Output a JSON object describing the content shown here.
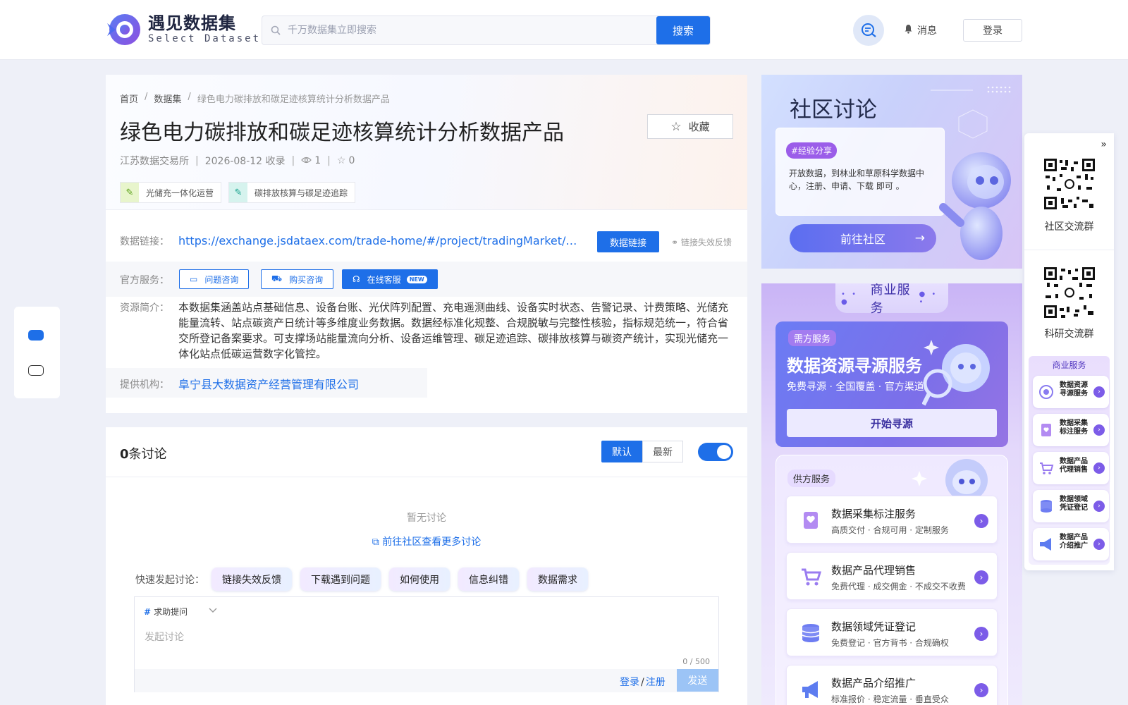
{
  "header": {
    "logo_cn": "遇见数据集",
    "logo_en": "Select Dataset",
    "search_placeholder": "千万数据集立即搜索",
    "search_button": "搜索",
    "messages_label": "消息",
    "login_button": "登录"
  },
  "dataset": {
    "breadcrumb": [
      "首页",
      "数据集",
      "绿色电力碳排放和碳足迹核算统计分析数据产品"
    ],
    "title": "绿色电力碳排放和碳足迹核算统计分析数据产品",
    "favorite_label": "收藏",
    "source": "江苏数据交易所",
    "date": "2026-08-12 收录",
    "views": "1",
    "stars": "0",
    "tags": [
      "光储充一体化运营",
      "碳排放核算与碳足迹追踪"
    ],
    "data_link_label": "数据链接：",
    "data_link_url": "https://exchange.jsdataex.com/trade-home/#/project/tradingMarket/productDet...",
    "data_link_button": "数据链接",
    "link_feedback": "链接失效反馈",
    "official_label": "官方服务：",
    "services": [
      "问题咨询",
      "购买咨询",
      "在线客服"
    ],
    "new_badge": "NEW",
    "desc_label": "资源简介：",
    "description": "本数据集涵盖站点基础信息、设备台账、光伏阵列配置、充电遥测曲线、设备实时状态、告警记录、计费策略、光储充能量流转、站点碳资产日统计等多维度业务数据。数据经标准化规整、合规脱敏与完整性核验，指标规范统一，符合省交所登记备案要求。可支撑场站能量流向分析、设备运维管理、碳足迹追踪、碳排放核算与碳资产统计，实现光储充一体化站点低碳运营数字化管控。",
    "provider_label": "提供机构：",
    "provider": "阜宁县大数据资产经营管理有限公司"
  },
  "discussion": {
    "count": "0",
    "count_suffix": "条讨论",
    "sort_default": "默认",
    "sort_latest": "最新",
    "toggle_on": true,
    "empty_text": "暂无讨论",
    "goto_community": "前往社区查看更多讨论",
    "quick_label": "快速发起讨论：",
    "quick_chips": [
      "链接失效反馈",
      "下载遇到问题",
      "如何使用",
      "信息纠错",
      "数据需求"
    ],
    "type_label": "求助提问",
    "input_placeholder": "发起讨论",
    "counter": "0 / 500",
    "login_link": "登录",
    "register_link": "注册",
    "send_button": "发送"
  },
  "community": {
    "title": "社区讨论",
    "tag": "#经验分享",
    "text": "开放数据，到林业和草原科学数据中心，注册、申请、下载 即可 。",
    "button": "前往社区"
  },
  "business": {
    "title": "商业服务",
    "demand_tag": "需方服务",
    "demand_title": "数据资源寻源服务",
    "demand_sub": "免费寻源 · 全国覆盖 · 官方渠道",
    "demand_button": "开始寻源",
    "supply_tag": "供方服务",
    "supply_items": [
      {
        "title": "数据采集标注服务",
        "sub": "高质交付 · 合规可用 · 定制服务"
      },
      {
        "title": "数据产品代理销售",
        "sub": "免费代理 · 成交佣金 · 不成交不收费"
      },
      {
        "title": "数据领域凭证登记",
        "sub": "免费登记 · 官方背书 · 合规确权"
      },
      {
        "title": "数据产品介绍推广",
        "sub": "标准报价 · 稳定流量 · 垂直受众"
      }
    ]
  },
  "right_float": {
    "qr1_label": "社区交流群",
    "qr2_label": "科研交流群",
    "biz_title": "商业服务",
    "items": [
      {
        "l1": "数据资源",
        "l2": "寻源服务"
      },
      {
        "l1": "数据采集",
        "l2": "标注服务"
      },
      {
        "l1": "数据产品",
        "l2": "代理销售"
      },
      {
        "l1": "数据领域",
        "l2": "凭证登记"
      },
      {
        "l1": "数据产品",
        "l2": "介绍推广"
      }
    ]
  },
  "colors": {
    "primary": "#1e6fe8",
    "purple": "#7c5ce8"
  }
}
